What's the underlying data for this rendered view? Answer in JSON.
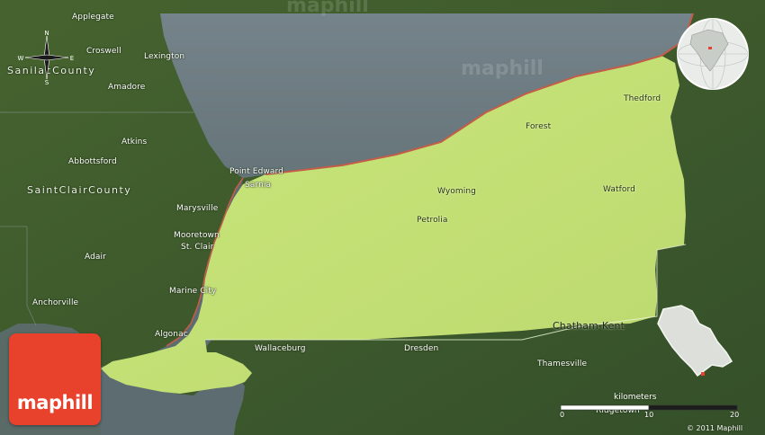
{
  "map": {
    "provider": "maphill",
    "style": "physical",
    "background_colors": {
      "land": "#3d5a2a",
      "water": "#6e7c80",
      "region": "#c7e37a",
      "border": "#c35c48"
    }
  },
  "labels": {
    "applegate": "Applegate",
    "croswell": "Croswell",
    "sanilac_county": "SanilacCounty",
    "lexington": "Lexington",
    "amadore": "Amadore",
    "atkins": "Atkins",
    "abbottsford": "Abbottsford",
    "saint_clair_county": "SaintClairCounty",
    "point_edward": "Point Edward",
    "sarnia": "Sarnia",
    "marysville": "Marysville",
    "mooretown": "Mooretown",
    "st_clair": "St. Clair",
    "adair": "Adair",
    "marine_city": "Marine City",
    "anchorville": "Anchorville",
    "algonac": "Algonac",
    "wallaceburg": "Wallaceburg",
    "dresden": "Dresden",
    "thamesville": "Thamesville",
    "chatham_kent": "Chatham-Kent",
    "forest": "Forest",
    "thedford": "Thedford",
    "wyoming": "Wyoming",
    "watford": "Watford",
    "petrolia": "Petrolia",
    "ridgetown": "Ridgetown"
  },
  "watermarks": [
    "maphill",
    "maphill"
  ],
  "compass": {
    "n": "N",
    "s": "S",
    "e": "E",
    "w": "W"
  },
  "logo": {
    "text": "maphill"
  },
  "scale": {
    "title": "kilometers",
    "ticks": [
      "0",
      "10",
      "20"
    ]
  },
  "copyright": "© 2011 Maphill"
}
